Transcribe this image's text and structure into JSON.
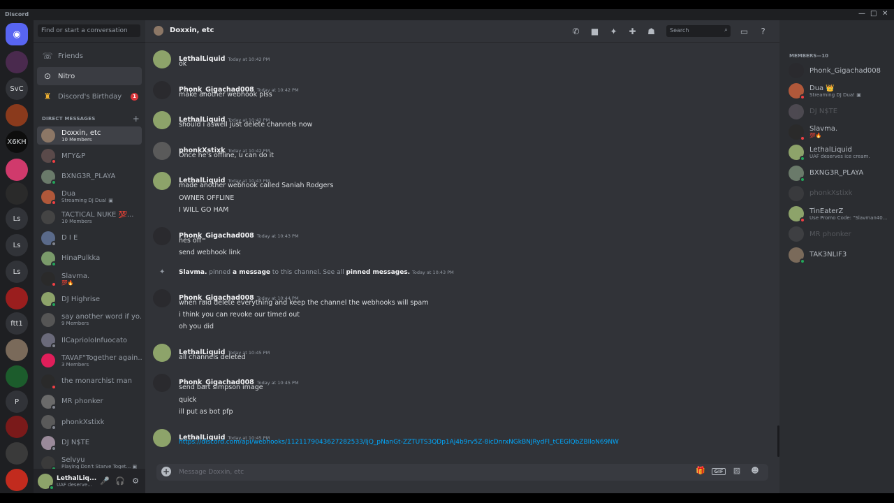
{
  "app": {
    "title": "Discord"
  },
  "window_controls": {
    "minimize": "—",
    "maximize": "□",
    "close": "✕"
  },
  "servers": [
    {
      "label": "",
      "icon": "discord-logo-icon",
      "color": "#5865f2"
    },
    {
      "label": "",
      "color": "#4a2a4e"
    },
    {
      "label": "SvC",
      "color": "#313338"
    },
    {
      "label": "",
      "color": "#8a3a1c"
    },
    {
      "label": "X6KH",
      "color": "#0d0d0d"
    },
    {
      "label": "",
      "color": "#d03a6c"
    },
    {
      "label": "",
      "color": "#2a2a2a"
    },
    {
      "label": "Ls",
      "color": "#313338"
    },
    {
      "label": "Ls",
      "color": "#313338"
    },
    {
      "label": "Ls",
      "color": "#313338"
    },
    {
      "label": "",
      "color": "#9a1e1e"
    },
    {
      "label": "ftt1",
      "color": "#313338"
    },
    {
      "label": "",
      "color": "#7a6a5a"
    },
    {
      "label": "",
      "color": "#1c5c2c"
    },
    {
      "label": "P",
      "color": "#313338"
    },
    {
      "label": "",
      "color": "#7a1a1a"
    },
    {
      "label": "",
      "color": "#3a3a3a"
    },
    {
      "label": "",
      "color": "#c22b1e"
    }
  ],
  "dm_search": {
    "placeholder": "Find or start a conversation"
  },
  "nav": [
    {
      "label": "Friends",
      "icon": "friends-icon"
    },
    {
      "label": "Nitro",
      "icon": "nitro-icon"
    },
    {
      "label": "Discord's Birthday",
      "icon": "birthday-icon",
      "badge": "1"
    }
  ],
  "dm_header": {
    "label": "DIRECT MESSAGES",
    "add": "+"
  },
  "dms": [
    {
      "name": "Doxxin, etc",
      "sub": "10 Members",
      "color": "#8c7766",
      "status": "",
      "active": true
    },
    {
      "name": "ΜΓΥ&Ρ",
      "sub": "",
      "color": "#5a4a4a",
      "status": "dnd"
    },
    {
      "name": "BXNG3R_PLAYA",
      "sub": "",
      "color": "#6a7a6a",
      "status": "on"
    },
    {
      "name": "Dua",
      "sub": "Streaming DJ Dua! ▣",
      "color": "#b0583a",
      "status": "dnd"
    },
    {
      "name": "TACTICAL NUKE 💯...",
      "sub": "10 Members",
      "color": "#444",
      "status": ""
    },
    {
      "name": "D I E",
      "sub": "",
      "color": "#5a6a8a",
      "status": "off"
    },
    {
      "name": "HinaPulkka",
      "sub": "",
      "color": "#7a9a6a",
      "status": "on"
    },
    {
      "name": "Slavma.",
      "sub": "💯🔥",
      "color": "#2a2a2a",
      "status": "dnd"
    },
    {
      "name": "DJ Highrise",
      "sub": "",
      "color": "#8da36a",
      "status": "on"
    },
    {
      "name": "say another word if yo...",
      "sub": "9 Members",
      "color": "#555",
      "status": ""
    },
    {
      "name": "IlCaprioloInfuocato",
      "sub": "",
      "color": "#6a6a7a",
      "status": "off"
    },
    {
      "name": "TAVAF\"Together again...",
      "sub": "3 Members",
      "color": "#e01e5a",
      "status": ""
    },
    {
      "name": "the monarchist man",
      "sub": "",
      "color": "#2a2a2a",
      "status": "dnd"
    },
    {
      "name": "MR phonker",
      "sub": "",
      "color": "#6a6a6a",
      "status": "off"
    },
    {
      "name": "phonkXstixk",
      "sub": "",
      "color": "#5a5a5a",
      "status": "off"
    },
    {
      "name": "DJ N$TE",
      "sub": "",
      "color": "#9a8a9a",
      "status": "off"
    },
    {
      "name": "Selvyu",
      "sub": "Playing Don't Starve Toget... ▣",
      "color": "#3a3a3a",
      "status": "on"
    }
  ],
  "user": {
    "name": "LethalLiq...",
    "sub": "UAF deserve...",
    "mute": "🎤",
    "deafen": "🎧",
    "settings": "⚙"
  },
  "chat": {
    "title": "Doxxin, etc",
    "search_placeholder": "Search",
    "composer_placeholder": "Message Doxxin, etc",
    "messages": [
      {
        "author": "LethalLiquid",
        "time": "Today at 10:42 PM",
        "color": "#8da36a",
        "lines": [
          "ok"
        ]
      },
      {
        "author": "Phonk_Gigachad008",
        "time": "Today at 10:42 PM",
        "color": "#2a2a2e",
        "lines": [
          "make another webhook plss"
        ]
      },
      {
        "author": "LethalLiquid",
        "time": "Today at 10:42 PM",
        "color": "#8da36a",
        "lines": [
          "should i aswell just delete channels now"
        ]
      },
      {
        "author": "phonkXstixk",
        "time": "Today at 10:42 PM",
        "color": "#5a5a5a",
        "lines": [
          "Once he's offline, u can do it"
        ]
      },
      {
        "author": "LethalLiquid",
        "time": "Today at 10:43 PM",
        "color": "#8da36a",
        "lines": [
          "made another webhook called Saniah Rodgers",
          "OWNER OFFLINE",
          "I WILL GO HAM"
        ]
      },
      {
        "author": "Phonk_Gigachad008",
        "time": "Today at 10:43 PM",
        "color": "#2a2a2e",
        "lines": [
          "hes off",
          "send webhook link"
        ]
      }
    ],
    "system": {
      "user": "Slavma.",
      "pinned": "pinned",
      "a_message": "a message",
      "rest": "to this channel. See all",
      "pinned_messages": "pinned messages.",
      "time": "Today at 10:43 PM"
    },
    "messages2": [
      {
        "author": "Phonk_Gigachad008",
        "time": "Today at 10:44 PM",
        "color": "#2a2a2e",
        "lines": [
          "when raid delete everything and keep the channel the webhooks will spam",
          "i think you can revoke our timed out",
          "oh you did"
        ]
      },
      {
        "author": "LethalLiquid",
        "time": "Today at 10:45 PM",
        "color": "#8da36a",
        "lines": [
          "all channels deleted"
        ]
      },
      {
        "author": "Phonk_Gigachad008",
        "time": "Today at 10:45 PM",
        "color": "#2a2a2e",
        "lines": [
          "send bart simpson image",
          "quick",
          "ill put as bot pfp"
        ]
      },
      {
        "author": "LethalLiquid",
        "time": "Today at 10:45 PM",
        "color": "#8da36a",
        "lines": [],
        "link": "https://discord.com/api/webhooks/1121179043627282533/ljQ_pNanGt-ZZTUTS3QDp1Aj4b9rv5Z-8icDnrxNGkBNJRydFl_tCEGlQbZBlloN69NW"
      }
    ]
  },
  "members": {
    "header": "MEMBERS—10",
    "list": [
      {
        "name": "Phonk_Gigachad008",
        "sub": "",
        "color": "#2a2a2e",
        "status": "off",
        "offline": false
      },
      {
        "name": "Dua 👑",
        "sub": "Streaming DJ Dua! ▣",
        "color": "#b0583a",
        "status": "dnd",
        "offline": false
      },
      {
        "name": "DJ N$TE",
        "sub": "",
        "color": "#9a8a9a",
        "status": "off",
        "offline": true
      },
      {
        "name": "Slavma.",
        "sub": "💯🔥",
        "color": "#2a2a2a",
        "status": "dnd",
        "offline": false
      },
      {
        "name": "LethalLiquid",
        "sub": "UAF deserves ice cream.",
        "color": "#8da36a",
        "status": "on",
        "offline": false
      },
      {
        "name": "BXNG3R_PLAYA",
        "sub": "",
        "color": "#6a7a6a",
        "status": "on",
        "offline": false
      },
      {
        "name": "phonkXstixk",
        "sub": "",
        "color": "#5a5a5a",
        "status": "off",
        "offline": true
      },
      {
        "name": "TinEaterZ",
        "sub": "Use Promo Code: \"Slavman40...",
        "color": "#8da36a",
        "status": "dnd",
        "offline": false
      },
      {
        "name": "MR phonker",
        "sub": "",
        "color": "#6a6a6a",
        "status": "off",
        "offline": true
      },
      {
        "name": "TAK3NLIF3",
        "sub": "",
        "color": "#7a6a5a",
        "status": "on",
        "offline": false
      }
    ]
  }
}
